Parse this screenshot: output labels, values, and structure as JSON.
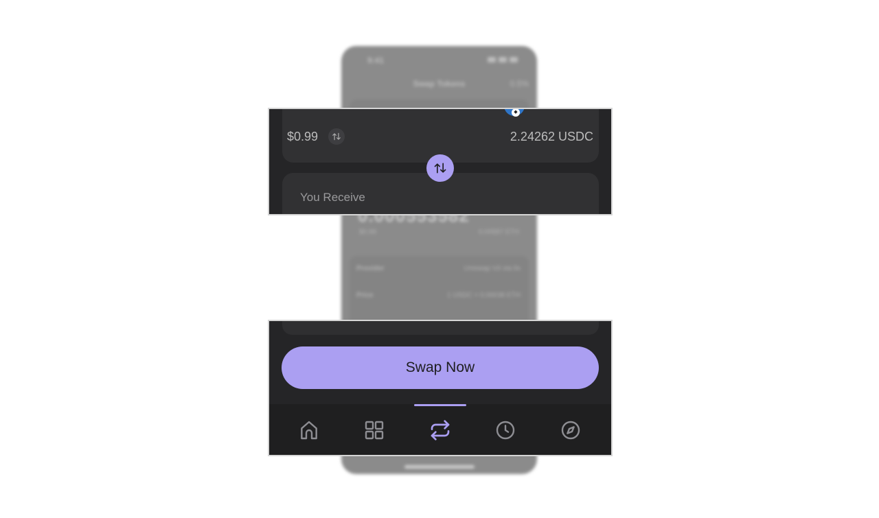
{
  "background_phone": {
    "time": "9:41",
    "title": "Swap Tokens",
    "slippage": "0.5%",
    "receive_amount": "0.000553582",
    "receive_usd": "$0.99",
    "receive_balance": "0.00987 ETH",
    "provider_label": "Provider",
    "provider_value": "Uniswap V4 via 0x",
    "price_label": "Price",
    "price_value": "1 USDC = 0.00038 ETH"
  },
  "pay": {
    "usd_value": "$0.99",
    "balance": "2.24262 USDC"
  },
  "receive": {
    "label": "You Receive"
  },
  "swap_button": {
    "label": "Swap Now"
  },
  "tabbar": {
    "active": "swap",
    "items": [
      {
        "icon": "home-icon"
      },
      {
        "icon": "grid-icon"
      },
      {
        "icon": "swap-icon"
      },
      {
        "icon": "clock-icon"
      },
      {
        "icon": "compass-icon"
      }
    ]
  },
  "colors": {
    "accent": "#ab9ff2",
    "panel": "#252527",
    "card": "#313133",
    "tab_inactive": "#8e8e93"
  }
}
